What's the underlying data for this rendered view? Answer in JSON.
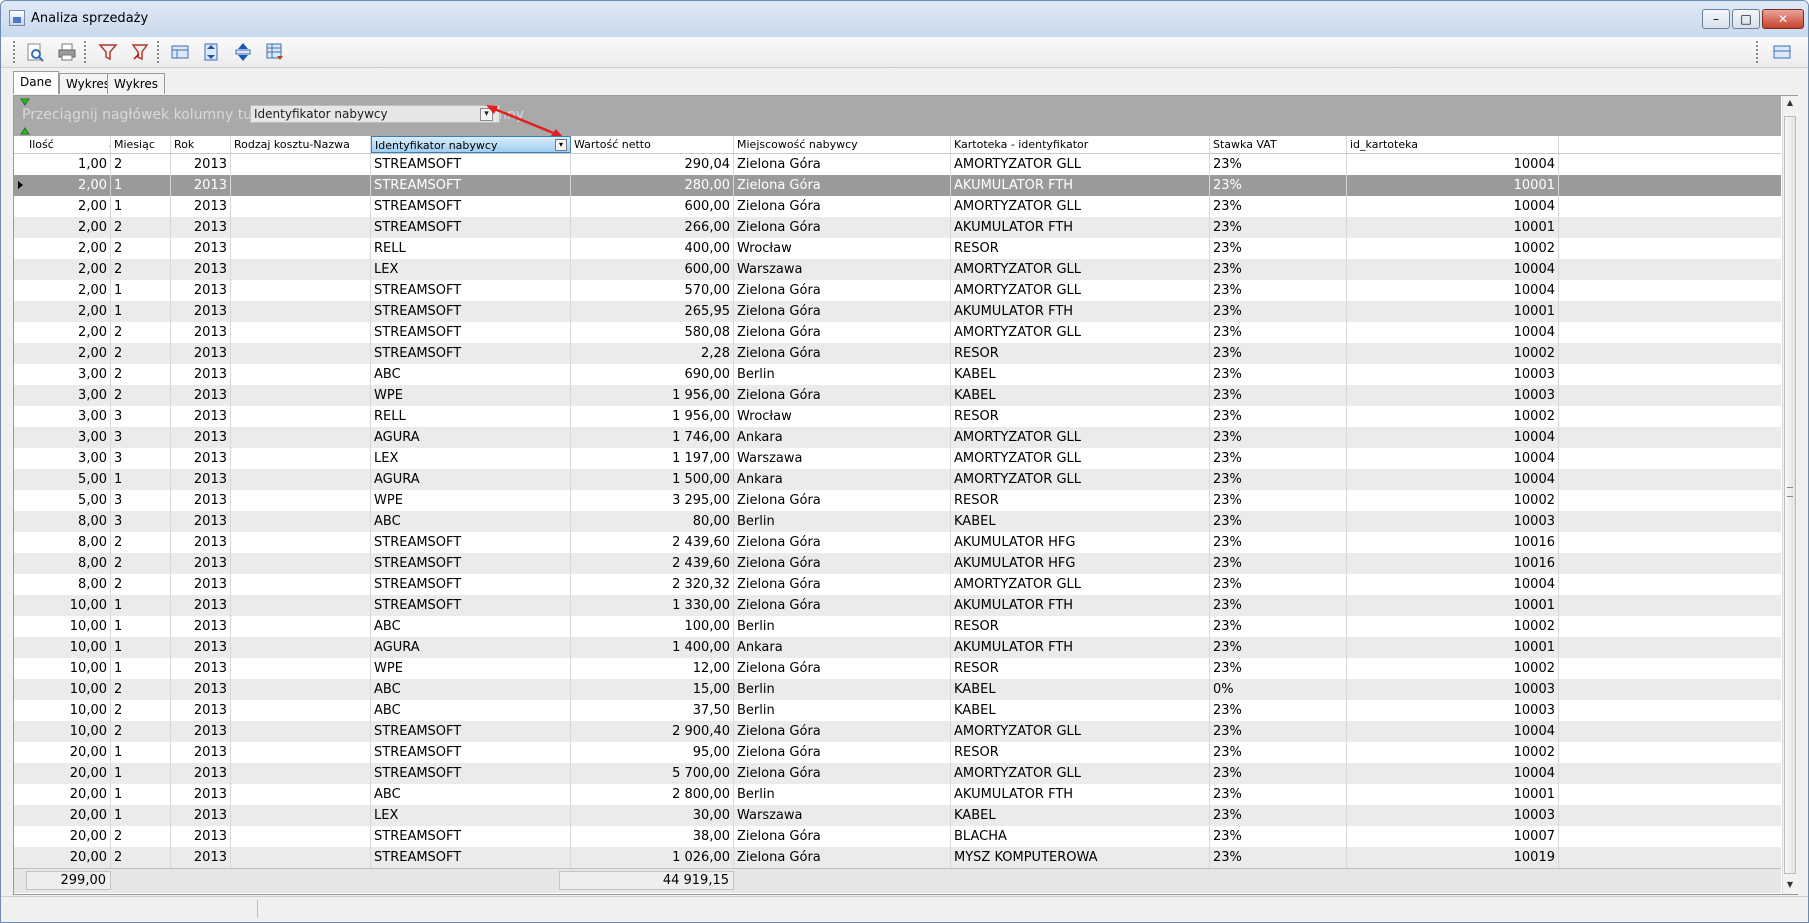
{
  "window": {
    "title": "Analiza sprzedaży",
    "min_label": "–",
    "max_label": "□",
    "close_label": "✕"
  },
  "toolbar": {
    "buttons": [
      "preview-icon",
      "print-icon",
      "filter-icon",
      "filter-clear-icon",
      "columns-icon",
      "expand-icon",
      "collapse-icon",
      "export-icon"
    ],
    "right_button": "layout-icon"
  },
  "tabs": [
    "Dane",
    "Wykres",
    "Wykres serii"
  ],
  "group_panel": {
    "hint": "Przeciągnij nagłówek kolumny tutaj by pogrupować według tej kolumny",
    "drag_chip": "Identyfikator nabywcy"
  },
  "columns": [
    "Ilość",
    "Miesiąc",
    "Rok",
    "Rodzaj kosztu-Nazwa",
    "Identyfikator nabywcy",
    "Wartość netto",
    "Miejscowość nabywcy",
    "Kartoteka - identyfikator",
    "Stawka VAT",
    "id_kartoteka"
  ],
  "rows": [
    [
      "1,00",
      "2",
      "2013",
      "",
      "STREAMSOFT",
      "290,04",
      "Zielona Góra",
      "AMORTYZATOR GLL",
      "23%",
      "10004"
    ],
    [
      "2,00",
      "1",
      "2013",
      "",
      "STREAMSOFT",
      "280,00",
      "Zielona Góra",
      "AKUMULATOR FTH",
      "23%",
      "10001"
    ],
    [
      "2,00",
      "1",
      "2013",
      "",
      "STREAMSOFT",
      "600,00",
      "Zielona Góra",
      "AMORTYZATOR GLL",
      "23%",
      "10004"
    ],
    [
      "2,00",
      "2",
      "2013",
      "",
      "STREAMSOFT",
      "266,00",
      "Zielona Góra",
      "AKUMULATOR FTH",
      "23%",
      "10001"
    ],
    [
      "2,00",
      "2",
      "2013",
      "",
      "RELL",
      "400,00",
      "Wrocław",
      "RESOR",
      "23%",
      "10002"
    ],
    [
      "2,00",
      "2",
      "2013",
      "",
      "LEX",
      "600,00",
      "Warszawa",
      "AMORTYZATOR GLL",
      "23%",
      "10004"
    ],
    [
      "2,00",
      "1",
      "2013",
      "",
      "STREAMSOFT",
      "570,00",
      "Zielona Góra",
      "AMORTYZATOR GLL",
      "23%",
      "10004"
    ],
    [
      "2,00",
      "1",
      "2013",
      "",
      "STREAMSOFT",
      "265,95",
      "Zielona Góra",
      "AKUMULATOR FTH",
      "23%",
      "10001"
    ],
    [
      "2,00",
      "2",
      "2013",
      "",
      "STREAMSOFT",
      "580,08",
      "Zielona Góra",
      "AMORTYZATOR GLL",
      "23%",
      "10004"
    ],
    [
      "2,00",
      "2",
      "2013",
      "",
      "STREAMSOFT",
      "2,28",
      "Zielona Góra",
      "RESOR",
      "23%",
      "10002"
    ],
    [
      "3,00",
      "2",
      "2013",
      "",
      "ABC",
      "690,00",
      "Berlin",
      "KABEL",
      "23%",
      "10003"
    ],
    [
      "3,00",
      "2",
      "2013",
      "",
      "WPE",
      "1 956,00",
      "Zielona Góra",
      "KABEL",
      "23%",
      "10003"
    ],
    [
      "3,00",
      "3",
      "2013",
      "",
      "RELL",
      "1 956,00",
      "Wrocław",
      "RESOR",
      "23%",
      "10002"
    ],
    [
      "3,00",
      "3",
      "2013",
      "",
      "AGURA",
      "1 746,00",
      "Ankara",
      "AMORTYZATOR GLL",
      "23%",
      "10004"
    ],
    [
      "3,00",
      "3",
      "2013",
      "",
      "LEX",
      "1 197,00",
      "Warszawa",
      "AMORTYZATOR GLL",
      "23%",
      "10004"
    ],
    [
      "5,00",
      "1",
      "2013",
      "",
      "AGURA",
      "1 500,00",
      "Ankara",
      "AMORTYZATOR GLL",
      "23%",
      "10004"
    ],
    [
      "5,00",
      "3",
      "2013",
      "",
      "WPE",
      "3 295,00",
      "Zielona Góra",
      "RESOR",
      "23%",
      "10002"
    ],
    [
      "8,00",
      "3",
      "2013",
      "",
      "ABC",
      "80,00",
      "Berlin",
      "KABEL",
      "23%",
      "10003"
    ],
    [
      "8,00",
      "2",
      "2013",
      "",
      "STREAMSOFT",
      "2 439,60",
      "Zielona Góra",
      "AKUMULATOR HFG",
      "23%",
      "10016"
    ],
    [
      "8,00",
      "2",
      "2013",
      "",
      "STREAMSOFT",
      "2 439,60",
      "Zielona Góra",
      "AKUMULATOR HFG",
      "23%",
      "10016"
    ],
    [
      "8,00",
      "2",
      "2013",
      "",
      "STREAMSOFT",
      "2 320,32",
      "Zielona Góra",
      "AMORTYZATOR GLL",
      "23%",
      "10004"
    ],
    [
      "10,00",
      "1",
      "2013",
      "",
      "STREAMSOFT",
      "1 330,00",
      "Zielona Góra",
      "AKUMULATOR FTH",
      "23%",
      "10001"
    ],
    [
      "10,00",
      "1",
      "2013",
      "",
      "ABC",
      "100,00",
      "Berlin",
      "RESOR",
      "23%",
      "10002"
    ],
    [
      "10,00",
      "1",
      "2013",
      "",
      "AGURA",
      "1 400,00",
      "Ankara",
      "AKUMULATOR FTH",
      "23%",
      "10001"
    ],
    [
      "10,00",
      "1",
      "2013",
      "",
      "WPE",
      "12,00",
      "Zielona Góra",
      "RESOR",
      "23%",
      "10002"
    ],
    [
      "10,00",
      "2",
      "2013",
      "",
      "ABC",
      "15,00",
      "Berlin",
      "KABEL",
      "0%",
      "10003"
    ],
    [
      "10,00",
      "2",
      "2013",
      "",
      "ABC",
      "37,50",
      "Berlin",
      "KABEL",
      "23%",
      "10003"
    ],
    [
      "10,00",
      "2",
      "2013",
      "",
      "STREAMSOFT",
      "2 900,40",
      "Zielona Góra",
      "AMORTYZATOR GLL",
      "23%",
      "10004"
    ],
    [
      "20,00",
      "1",
      "2013",
      "",
      "STREAMSOFT",
      "95,00",
      "Zielona Góra",
      "RESOR",
      "23%",
      "10002"
    ],
    [
      "20,00",
      "1",
      "2013",
      "",
      "STREAMSOFT",
      "5 700,00",
      "Zielona Góra",
      "AMORTYZATOR GLL",
      "23%",
      "10004"
    ],
    [
      "20,00",
      "1",
      "2013",
      "",
      "ABC",
      "2 800,00",
      "Berlin",
      "AKUMULATOR FTH",
      "23%",
      "10001"
    ],
    [
      "20,00",
      "1",
      "2013",
      "",
      "LEX",
      "30,00",
      "Warszawa",
      "KABEL",
      "23%",
      "10003"
    ],
    [
      "20,00",
      "2",
      "2013",
      "",
      "STREAMSOFT",
      "38,00",
      "Zielona Góra",
      "BLACHA",
      "23%",
      "10007"
    ],
    [
      "20,00",
      "2",
      "2013",
      "",
      "STREAMSOFT",
      "1 026,00",
      "Zielona Góra",
      "MYSZ KOMPUTEROWA",
      "23%",
      "10019"
    ]
  ],
  "selected_row": 1,
  "totals": {
    "ilosc": "299,00",
    "wartosc_netto": "44 919,15"
  }
}
